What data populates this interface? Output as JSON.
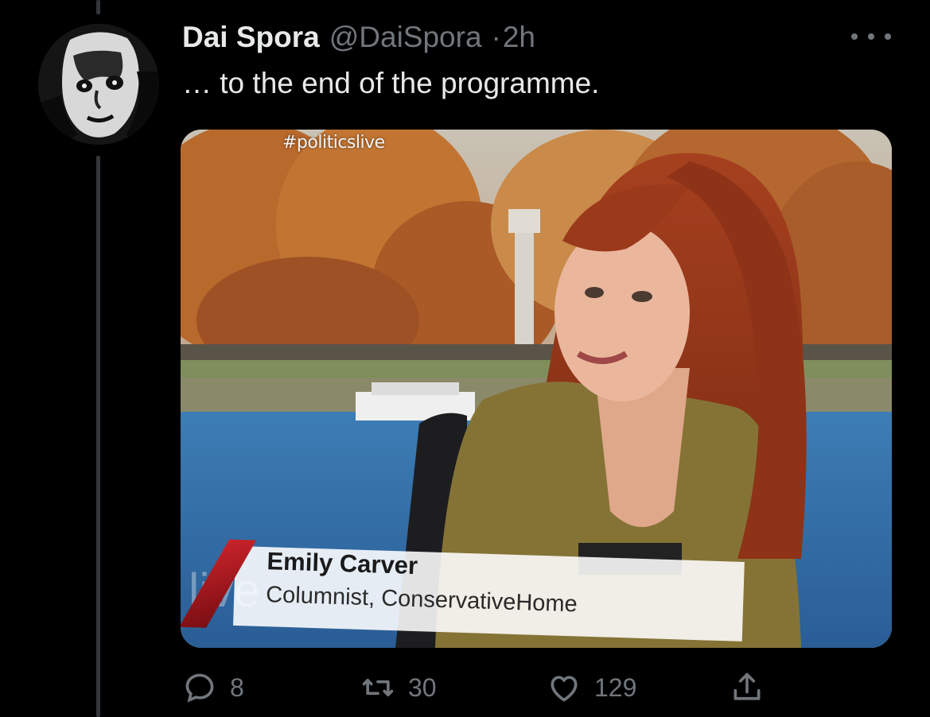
{
  "tweet": {
    "display_name": "Dai Spora",
    "handle": "@DaiSpora",
    "separator": "·",
    "time": "2h",
    "text": "… to the end of the programme."
  },
  "media": {
    "hashtag": "#politicslive",
    "caption_name": "Emily Carver",
    "caption_role": "Columnist, ConservativeHome",
    "watermark": "live"
  },
  "actions": {
    "replies": "8",
    "retweets": "30",
    "likes": "129"
  },
  "icons": [
    "more-icon",
    "reply-icon",
    "retweet-icon",
    "like-icon",
    "share-icon"
  ],
  "colors": {
    "background": "#000000",
    "text_primary": "#e7e9ea",
    "text_secondary": "#71767b",
    "thread_line": "#333639"
  }
}
